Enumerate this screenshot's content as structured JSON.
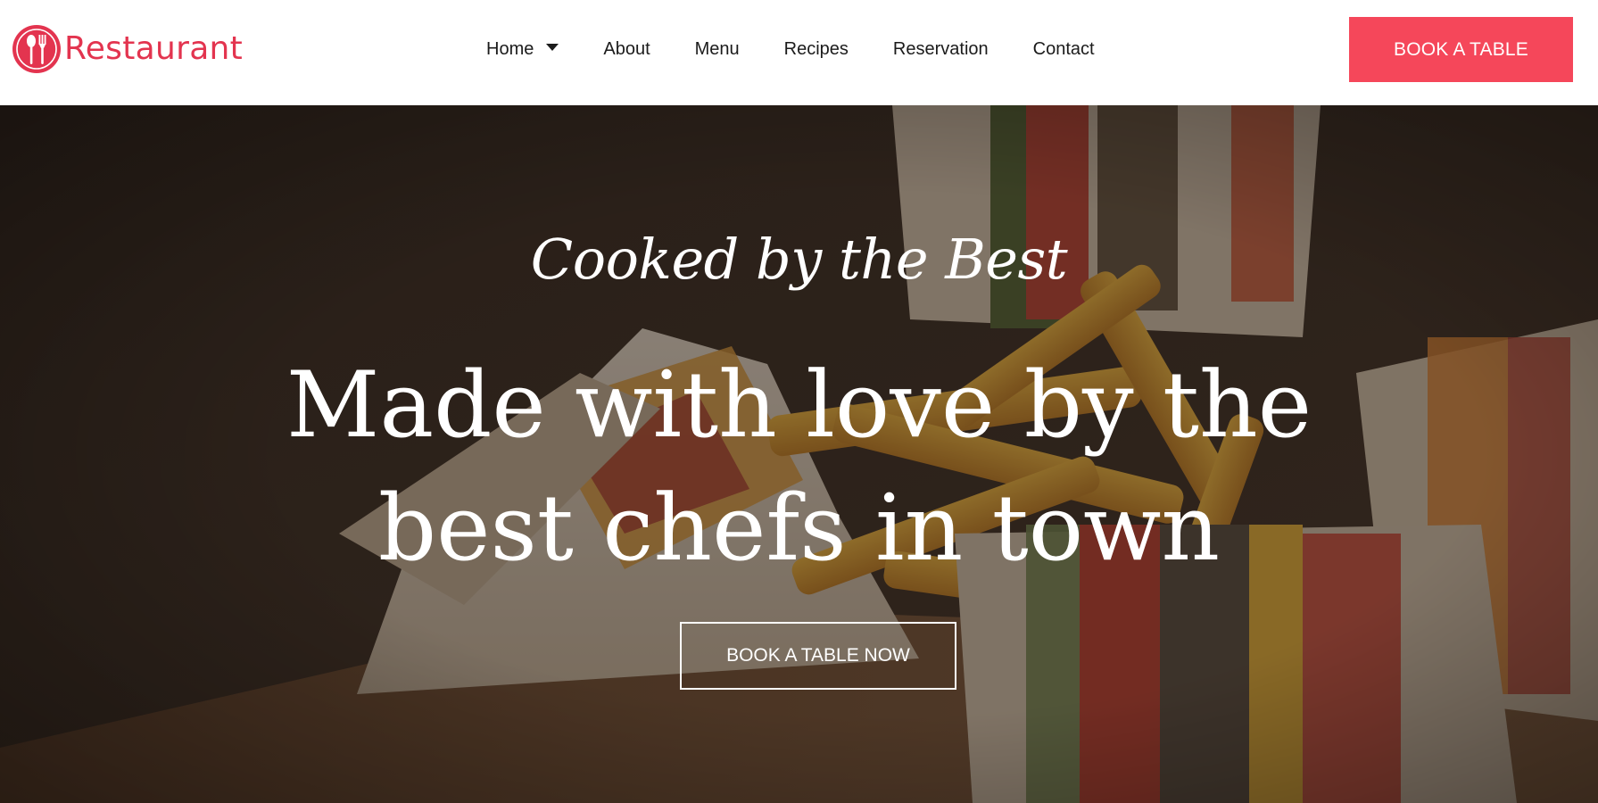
{
  "brand": {
    "name": "Restaurant",
    "logo_icon": "fork-spoon-icon",
    "accent_color": "#e3344f"
  },
  "nav": {
    "items": [
      {
        "label": "Home",
        "has_dropdown": true
      },
      {
        "label": "About"
      },
      {
        "label": "Menu"
      },
      {
        "label": "Recipes"
      },
      {
        "label": "Reservation"
      },
      {
        "label": "Contact"
      }
    ],
    "dropdown_icon": "caret-down-icon"
  },
  "header": {
    "cta_label": "BOOK A TABLE",
    "cta_color": "#f5475a"
  },
  "hero": {
    "subtitle": "Cooked by the Best",
    "title_line1": "Made with love by the",
    "title_line2": "best chefs in town",
    "cta_label": "BOOK A TABLE NOW",
    "background": "club-sandwich-fries-photo"
  }
}
